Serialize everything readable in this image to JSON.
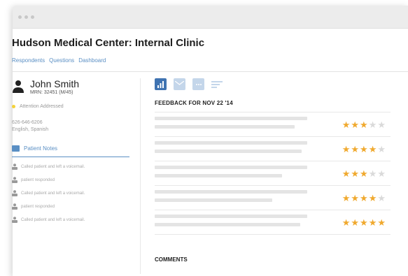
{
  "window": {
    "dots": 3
  },
  "header": {
    "title": "Hudson Medical Center: Internal Clinic"
  },
  "nav": {
    "items": [
      "Respondents",
      "Questions",
      "Dashboard"
    ]
  },
  "patient": {
    "name": "John Smith",
    "mrn": "MRN: 32451 (M/45)",
    "status": "Attention Addressed",
    "phone": "626-646-6206",
    "languages": "English, Spanish"
  },
  "notes": {
    "label": "Patient Notes",
    "items": [
      "Called patient and left a voicemail.",
      "patient responded",
      "Called patient and left a voicemail.",
      "patient responded",
      "Called patient and left a voicemail."
    ]
  },
  "tabs": [
    {
      "icon": "bar-chart-icon",
      "active": true
    },
    {
      "icon": "envelope-icon",
      "active": false
    },
    {
      "icon": "chat-bubble-icon",
      "active": false
    },
    {
      "icon": "list-lines-icon",
      "active": false
    }
  ],
  "feedback": {
    "title": "FEEDBACK FOR NOV 22 '14",
    "max_rating": 5,
    "ratings": [
      3,
      4,
      3,
      4,
      5
    ]
  },
  "comments": {
    "title": "COMMENTS"
  },
  "colors": {
    "accent": "#3f73b1",
    "link": "#5a8fc4",
    "star": "#f0a92e",
    "status": "#f4d23a"
  }
}
